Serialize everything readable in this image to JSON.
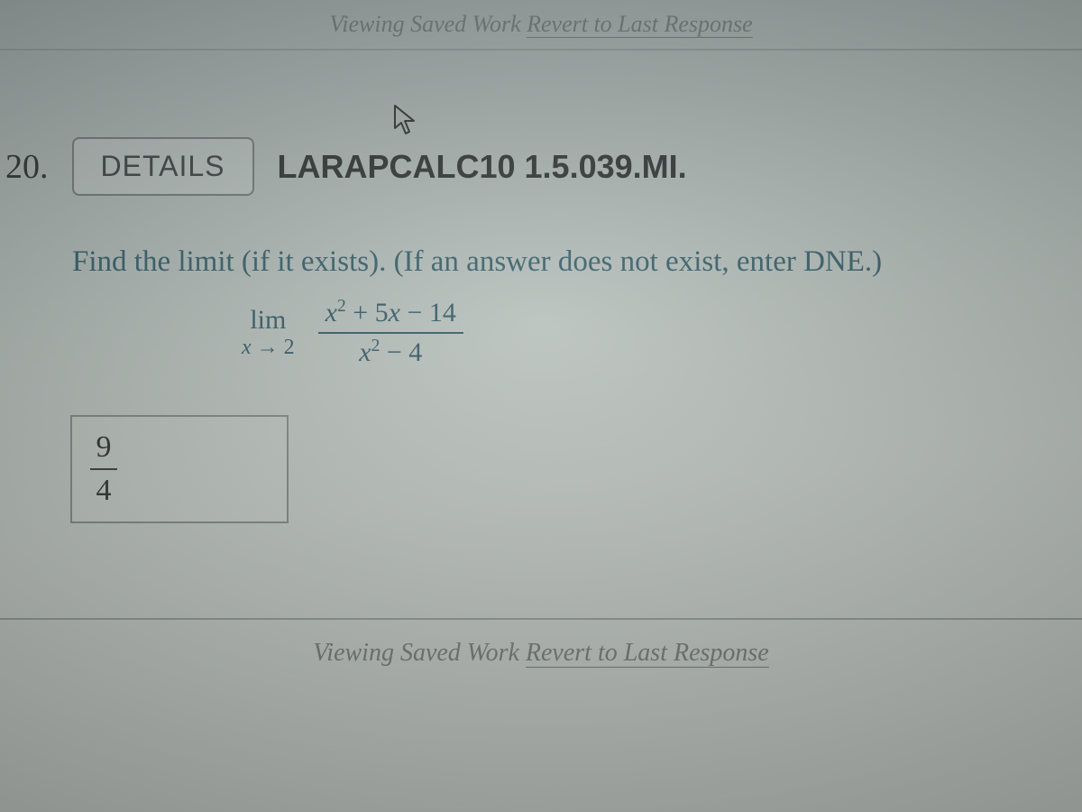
{
  "status": {
    "saved_prefix": "Viewing Saved Work ",
    "revert_link": "Revert to Last Response"
  },
  "question": {
    "number": "20.",
    "details_label": "DETAILS",
    "code": "LARAPCALC10 1.5.039.MI.",
    "prompt": "Find the limit (if it exists). (If an answer does not exist, enter DNE.)"
  },
  "limit": {
    "lim_word": "lim",
    "approach_var": "x",
    "arrow": "→",
    "approach_value": "2",
    "numerator_parts": {
      "var1": "x",
      "exp1": "2",
      "plus": " + 5",
      "var2": "x",
      "minus": " − 14"
    },
    "denominator_parts": {
      "var1": "x",
      "exp1": "2",
      "minus": " − 4"
    }
  },
  "answer": {
    "numerator": "9",
    "denominator": "4"
  }
}
